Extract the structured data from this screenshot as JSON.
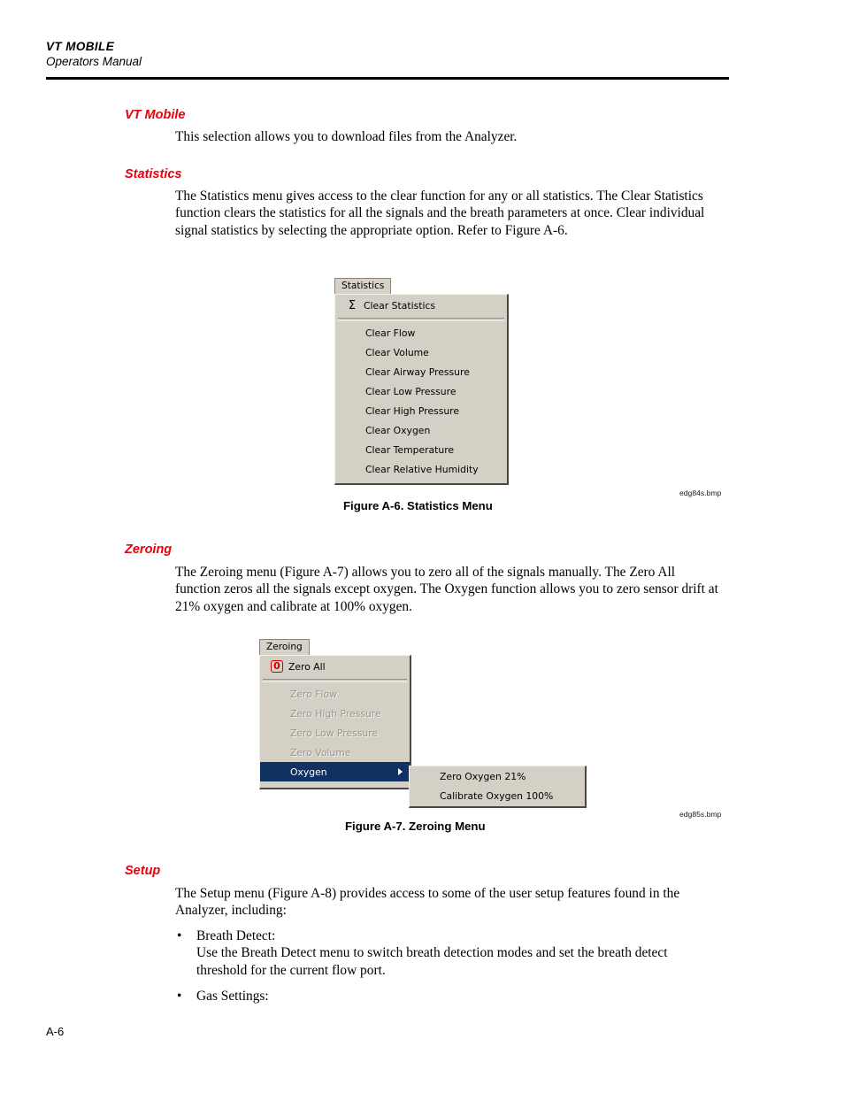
{
  "header": {
    "title": "VT MOBILE",
    "subtitle": "Operators Manual"
  },
  "sections": {
    "vt_mobile": {
      "heading": "VT Mobile",
      "paragraph": "This selection allows you to download files from the Analyzer."
    },
    "statistics": {
      "heading": "Statistics",
      "paragraph": "The Statistics menu gives access to the clear function for any or all statistics. The Clear Statistics function clears the statistics for all the signals and the breath parameters at once. Clear individual signal statistics by selecting the appropriate option. Refer to Figure A-6."
    },
    "zeroing": {
      "heading": "Zeroing",
      "paragraph": "The Zeroing menu (Figure A-7) allows you to zero all of the signals manually. The Zero All function zeros all the signals except oxygen. The Oxygen function allows you to zero sensor drift at 21% oxygen and calibrate at 100% oxygen."
    },
    "setup": {
      "heading": "Setup",
      "paragraph": "The Setup menu (Figure A-8) provides access to some of the user setup features found in the Analyzer, including:",
      "bullets": [
        {
          "marker": "•",
          "text": "Breath Detect:\nUse the Breath Detect menu to switch breath detection modes and set the breath detect threshold for the current flow port."
        },
        {
          "marker": "•",
          "text": "Gas Settings:"
        }
      ]
    }
  },
  "figures": {
    "statistics_menu": {
      "tab_label": "Statistics",
      "caption": "Figure A-6. Statistics Menu",
      "source_ref": "edg84s.bmp",
      "header_item": {
        "icon": "sigma-icon",
        "icon_glyph": "Σ",
        "label": "Clear Statistics"
      },
      "items": [
        {
          "label": "Clear Flow"
        },
        {
          "label": "Clear Volume"
        },
        {
          "label": "Clear Airway Pressure"
        },
        {
          "label": "Clear Low Pressure"
        },
        {
          "label": "Clear High Pressure"
        },
        {
          "label": "Clear Oxygen"
        },
        {
          "label": "Clear Temperature"
        },
        {
          "label": "Clear Relative Humidity"
        }
      ]
    },
    "zeroing_menu": {
      "tab_label": "Zeroing",
      "caption": "Figure A-7. Zeroing Menu",
      "source_ref": "edg85s.bmp",
      "header_item": {
        "icon": "zero-all-icon",
        "icon_glyph": "0",
        "label": "Zero All"
      },
      "items": [
        {
          "label": "Zero Flow",
          "state": "disabled"
        },
        {
          "label": "Zero High Pressure",
          "state": "disabled"
        },
        {
          "label": "Zero Low Pressure",
          "state": "disabled"
        },
        {
          "label": "Zero Volume",
          "state": "disabled"
        },
        {
          "label": "Oxygen",
          "state": "selected",
          "has_submenu": true
        }
      ],
      "submenu": [
        {
          "label": "Zero Oxygen 21%"
        },
        {
          "label": "Calibrate Oxygen 100%"
        }
      ]
    }
  },
  "footer": {
    "page_number": "A-6"
  },
  "colors": {
    "heading_red": "#e8000b",
    "menu_face": "#d4d0c6",
    "menu_selected": "#123163",
    "zero_icon_red": "#cc0000"
  }
}
